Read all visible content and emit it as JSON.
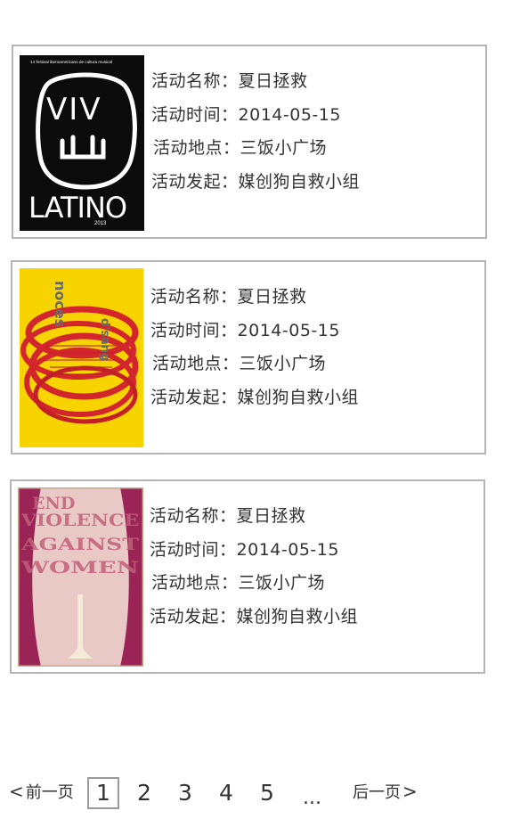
{
  "events": [
    {
      "poster_icon": "viva-latino-poster",
      "poster_texts": [
        "14 festival iberoamericano de cultura musical",
        "VIV",
        "LATINO",
        "2013"
      ],
      "fields": [
        {
          "label": "活动名称：",
          "value": "夏日拯救"
        },
        {
          "label": "活动时间：",
          "value": "2014-05-15"
        },
        {
          "label": "活动地点：",
          "value": "三饭小广场"
        },
        {
          "label": "活动发起：",
          "value": "媒创狗自救小组"
        }
      ]
    },
    {
      "poster_icon": "red-circles-poster",
      "poster_texts": [
        "noces",
        "d'sang"
      ],
      "fields": [
        {
          "label": "活动名称：",
          "value": "夏日拯救"
        },
        {
          "label": "活动时间：",
          "value": "2014-05-15"
        },
        {
          "label": "活动地点：",
          "value": "三饭小广场"
        },
        {
          "label": "活动发起：",
          "value": "媒创狗自救小组"
        }
      ]
    },
    {
      "poster_icon": "end-violence-poster",
      "poster_texts": [
        "END",
        "VIOLENCE",
        "AGAINST",
        "WOMEN"
      ],
      "fields": [
        {
          "label": "活动名称：",
          "value": "夏日拯救"
        },
        {
          "label": "活动时间：",
          "value": "2014-05-15"
        },
        {
          "label": "活动地点：",
          "value": "三饭小广场"
        },
        {
          "label": "活动发起：",
          "value": "媒创狗自救小组"
        }
      ]
    }
  ],
  "pagination": {
    "prev_icon": "chevron-left-icon",
    "prev_label": "前一页",
    "pages": [
      "1",
      "2",
      "3",
      "4",
      "5"
    ],
    "current_page": "1",
    "ellipsis": "...",
    "next_label": "后一页",
    "next_icon": "chevron-right-icon",
    "prev_glyph": "<",
    "next_glyph": ">"
  },
  "colors": {
    "card_border": "#b5b5b5",
    "text": "#333333",
    "poster1_bg": "#0b0b0b",
    "poster2_bg": "#f7d400",
    "poster2_ring": "#d3262c",
    "poster3_bg": "#e9c9c6",
    "poster3_side": "#9b2456"
  }
}
